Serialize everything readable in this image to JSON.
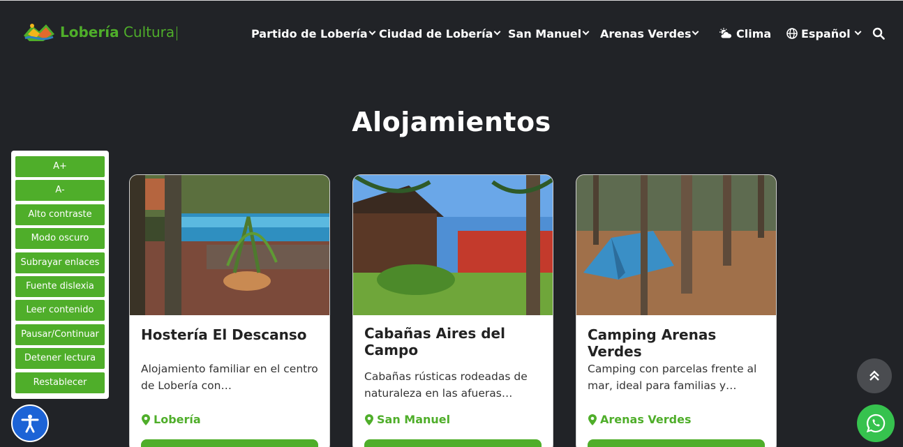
{
  "brand": {
    "name_bold": "Lobería",
    "name_light": "Cultura"
  },
  "nav": {
    "items": [
      {
        "label": "Partido de Lobería"
      },
      {
        "label": "Ciudad de Lobería"
      },
      {
        "label": "San Manuel"
      },
      {
        "label": "Arenas Verdes"
      }
    ],
    "weather_label": "Clima",
    "language_label": "Español",
    "icons": [
      "cloud-sun-icon",
      "globe-icon",
      "search-icon",
      "chevron-down-icon"
    ]
  },
  "page": {
    "title": "Alojamientos"
  },
  "accessibility": {
    "buttons": [
      "A+",
      "A-",
      "Alto contraste",
      "Modo oscuro",
      "Subrayar enlaces",
      "Fuente dislexia",
      "Leer contenido",
      "Pausar/Continuar",
      "Detener lectura",
      "Restablecer"
    ]
  },
  "cards": [
    {
      "title": "Hostería El Descanso",
      "description": "Alojamiento familiar en el centro de Lobería con…",
      "location": "Lobería"
    },
    {
      "title": "Cabañas Aires del Campo",
      "description": "Cabañas rústicas rodeadas de naturaleza en las afueras…",
      "location": "San Manuel"
    },
    {
      "title": "Camping Arenas Verdes",
      "description": "Camping con parcelas frente al mar, ideal para familias y…",
      "location": "Arenas Verdes"
    }
  ],
  "colors": {
    "background": "#212327",
    "accent_green": "#4fae2a",
    "fab_blue": "#1c63d6",
    "whatsapp_green": "#36c24e"
  }
}
